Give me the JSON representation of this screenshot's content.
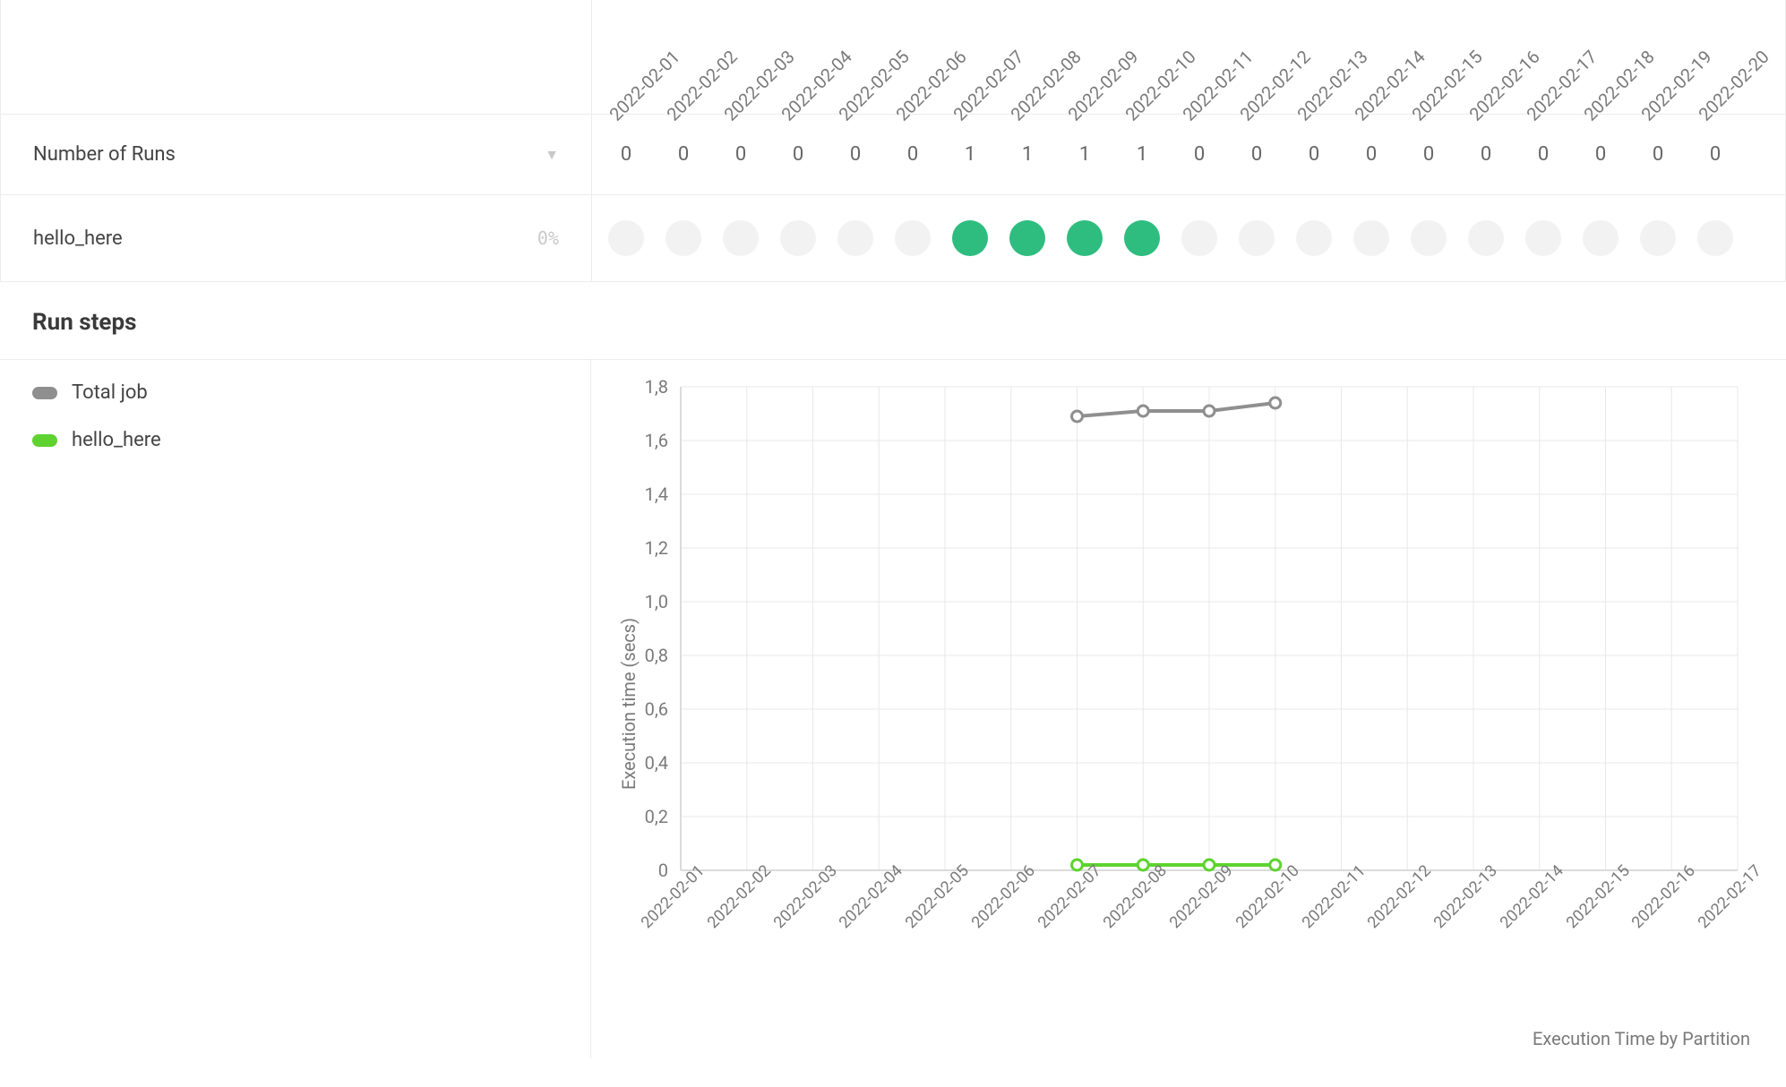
{
  "matrix": {
    "runs_label": "Number of Runs",
    "step_name": "hello_here",
    "step_pct": "0%",
    "dates": [
      "2022-02-01",
      "2022-02-02",
      "2022-02-03",
      "2022-02-04",
      "2022-02-05",
      "2022-02-06",
      "2022-02-07",
      "2022-02-08",
      "2022-02-09",
      "2022-02-10",
      "2022-02-11",
      "2022-02-12",
      "2022-02-13",
      "2022-02-14",
      "2022-02-15",
      "2022-02-16",
      "2022-02-17",
      "2022-02-18",
      "2022-02-19",
      "2022-02-20"
    ],
    "counts": [
      0,
      0,
      0,
      0,
      0,
      0,
      1,
      1,
      1,
      1,
      0,
      0,
      0,
      0,
      0,
      0,
      0,
      0,
      0,
      0
    ],
    "status": [
      "none",
      "none",
      "none",
      "none",
      "none",
      "none",
      "success",
      "success",
      "success",
      "success",
      "none",
      "none",
      "none",
      "none",
      "none",
      "none",
      "none",
      "none",
      "none",
      "none"
    ]
  },
  "runsteps_title": "Run steps",
  "legend": [
    {
      "name": "Total job",
      "color": "#8f8f8f"
    },
    {
      "name": "hello_here",
      "color": "#5ed32f"
    }
  ],
  "chart_data": {
    "type": "line",
    "title": "Execution Time by Partition",
    "ylabel": "Execution time (secs)",
    "xlabel": "",
    "ylim": [
      0,
      1.8
    ],
    "yticks": [
      0,
      0.2,
      0.4,
      0.6,
      0.8,
      1.0,
      1.2,
      1.4,
      1.6,
      1.8
    ],
    "ytick_labels": [
      "0",
      "0,2",
      "0,4",
      "0,6",
      "0,8",
      "1,0",
      "1,2",
      "1,4",
      "1,6",
      "1,8"
    ],
    "categories": [
      "2022-02-01",
      "2022-02-02",
      "2022-02-03",
      "2022-02-04",
      "2022-02-05",
      "2022-02-06",
      "2022-02-07",
      "2022-02-08",
      "2022-02-09",
      "2022-02-10",
      "2022-02-11",
      "2022-02-12",
      "2022-02-13",
      "2022-02-14",
      "2022-02-15",
      "2022-02-16",
      "2022-02-17"
    ],
    "series": [
      {
        "name": "Total job",
        "color": "#8f8f8f",
        "x": [
          "2022-02-07",
          "2022-02-08",
          "2022-02-09",
          "2022-02-10"
        ],
        "y": [
          1.69,
          1.71,
          1.71,
          1.74
        ]
      },
      {
        "name": "hello_here",
        "color": "#5ed32f",
        "x": [
          "2022-02-07",
          "2022-02-08",
          "2022-02-09",
          "2022-02-10"
        ],
        "y": [
          0.02,
          0.02,
          0.02,
          0.02
        ]
      }
    ]
  }
}
